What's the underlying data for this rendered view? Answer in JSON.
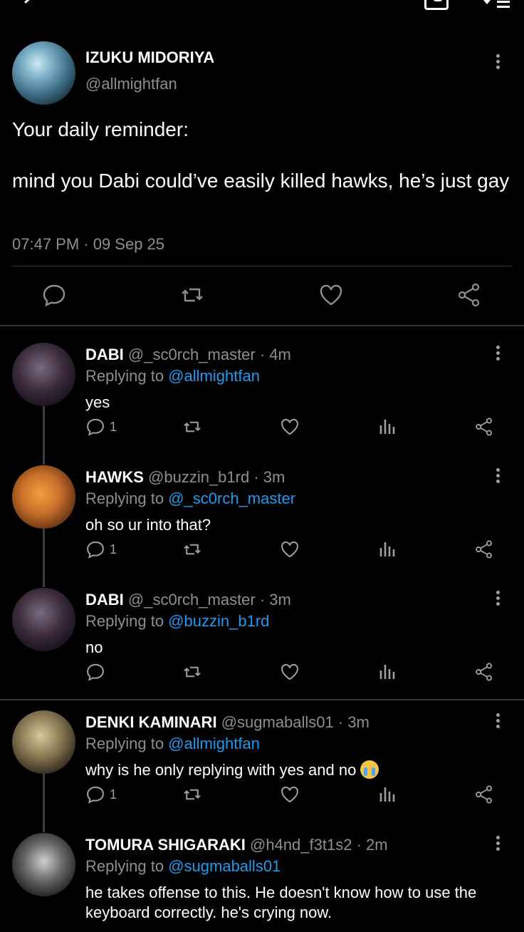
{
  "colors": {
    "background": "#000000",
    "text": "#e7e9ea",
    "muted": "#8b8f94",
    "mention": "#1d9bf0",
    "divider": "#2f3336"
  },
  "header": {
    "icons": [
      "back-arrow-icon",
      "image-icon",
      "heart-menu-icon"
    ]
  },
  "post": {
    "name": "IZUKU MIDORIYA",
    "handle": "@allmightfan",
    "text": "Your daily reminder:\n\nmind you Dabi could’ve easily killed hawks, he’s just gay",
    "time": "07:47 PM · 09 Sep 25",
    "actions": [
      "comment-icon",
      "retweet-icon",
      "like-icon",
      "share-icon"
    ]
  },
  "replies": [
    {
      "name": "DABI",
      "meta": "@_sc0rch_master · 4m",
      "replying_label": "Replying to",
      "mention": "@allmightfan",
      "text": "yes",
      "comment_count": "1",
      "avatar_color": "#3a2a3a"
    },
    {
      "name": "HAWKS",
      "meta": "@buzzin_b1rd · 3m",
      "replying_label": "Replying to",
      "mention": "@_sc0rch_master",
      "text": "oh so ur into that?",
      "comment_count": "1",
      "avatar_color": "#c8702a"
    },
    {
      "name": "DABI",
      "meta": "@_sc0rch_master · 3m",
      "replying_label": "Replying to",
      "mention": "@buzzin_b1rd",
      "text": "no",
      "comment_count": "",
      "avatar_color": "#3a2a3a"
    },
    {
      "name": "DENKI KAMINARI",
      "meta": "@sugmaballs01 · 3m",
      "replying_label": "Replying to",
      "mention": "@allmightfan",
      "text": "why is he only replying with yes and no",
      "emoji": "loudly-crying-face",
      "comment_count": "1",
      "avatar_color": "#8a7a55"
    },
    {
      "name": "TOMURA SHIGARAKI",
      "meta": "@h4nd_f3t1s2 · 2m",
      "replying_label": "Replying to",
      "mention": "@sugmaballs01",
      "text": "he takes offense to this. He doesn't know how to use the keyboard correctly. he's crying now.",
      "comment_count": "",
      "avatar_color": "#6a6a6a"
    }
  ]
}
